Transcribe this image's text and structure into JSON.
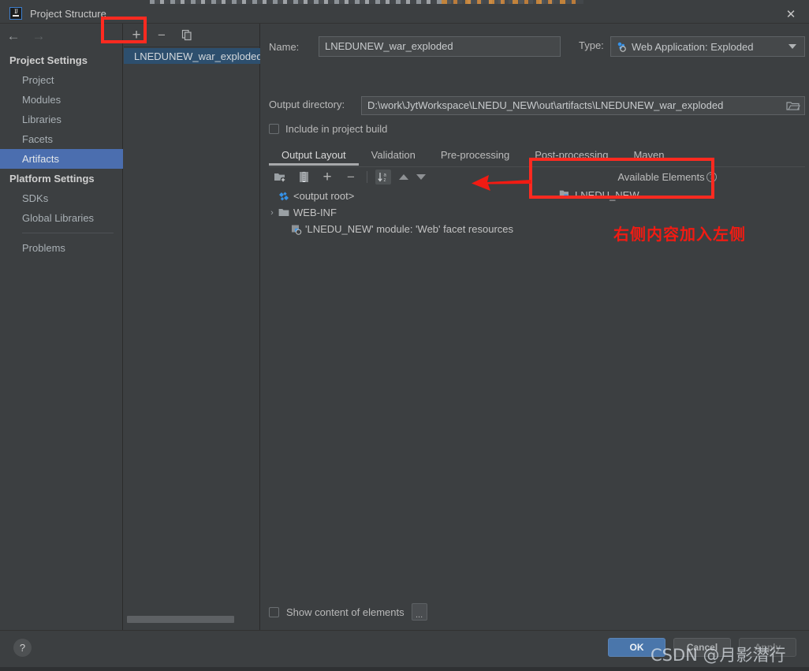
{
  "window": {
    "title": "Project Structure",
    "logo_text": "IJ",
    "close_label": "✕"
  },
  "nav": {
    "back": "←",
    "forward": "→"
  },
  "sidebar": {
    "groups": [
      {
        "label": "Project Settings",
        "items": [
          {
            "label": "Project",
            "selected": false
          },
          {
            "label": "Modules",
            "selected": false
          },
          {
            "label": "Libraries",
            "selected": false
          },
          {
            "label": "Facets",
            "selected": false
          },
          {
            "label": "Artifacts",
            "selected": true
          }
        ]
      },
      {
        "label": "Platform Settings",
        "items": [
          {
            "label": "SDKs",
            "selected": false
          },
          {
            "label": "Global Libraries",
            "selected": false
          }
        ]
      }
    ],
    "extra_item": "Problems"
  },
  "artifacts_panel": {
    "toolbar": {
      "add_label": "+",
      "remove_label": "−",
      "copy_label": "copy-icon"
    },
    "items": [
      {
        "label": "LNEDUNEW_war_exploded",
        "selected": true
      }
    ]
  },
  "detail": {
    "name_label": "Name:",
    "name_value": "LNEDUNEW_war_exploded",
    "type_label": "Type:",
    "type_value": "Web Application: Exploded",
    "output_dir_label": "Output directory:",
    "output_dir_value": "D:\\work\\JytWorkspace\\LNEDU_NEW\\out\\artifacts\\LNEDUNEW_war_exploded",
    "include_in_build_label": "Include in project build",
    "include_in_build_checked": false,
    "tabs": [
      {
        "label": "Output Layout",
        "active": true
      },
      {
        "label": "Validation",
        "active": false
      },
      {
        "label": "Pre-processing",
        "active": false
      },
      {
        "label": "Post-processing",
        "active": false
      },
      {
        "label": "Maven",
        "active": false
      }
    ],
    "layout_toolbar": {
      "create_dir": "add-directory-icon",
      "create_archive": "add-archive-icon",
      "add": "+",
      "remove": "−",
      "sort": "sort-az-icon",
      "move_up": "move-up-icon",
      "move_down": "move-down-icon"
    },
    "tree": [
      {
        "twisty": "",
        "icon": "output-root-icon",
        "label": "<output root>",
        "indent": 0
      },
      {
        "twisty": "›",
        "icon": "folder-icon",
        "label": "WEB-INF",
        "indent": 0
      },
      {
        "twisty": "",
        "icon": "facet-resources-icon",
        "label": "'LNEDU_NEW' module: 'Web' facet resources",
        "indent": 1
      }
    ],
    "available_elements_label": "Available Elements",
    "available_elements_help": "?",
    "available_elements": [
      {
        "icon": "module-icon",
        "label": "LNEDU_NEW"
      }
    ],
    "show_content_label": "Show content of elements",
    "show_content_checked": false,
    "ellipsis_label": "..."
  },
  "footer": {
    "help_label": "?",
    "ok_label": "OK",
    "cancel_label": "Cancel",
    "apply_label": "Apply"
  },
  "annotations": {
    "note_cn": "右侧内容加入左侧",
    "highlight_color": "#ff2a20"
  },
  "watermark": {
    "text": "CSDN @月影潜行"
  }
}
